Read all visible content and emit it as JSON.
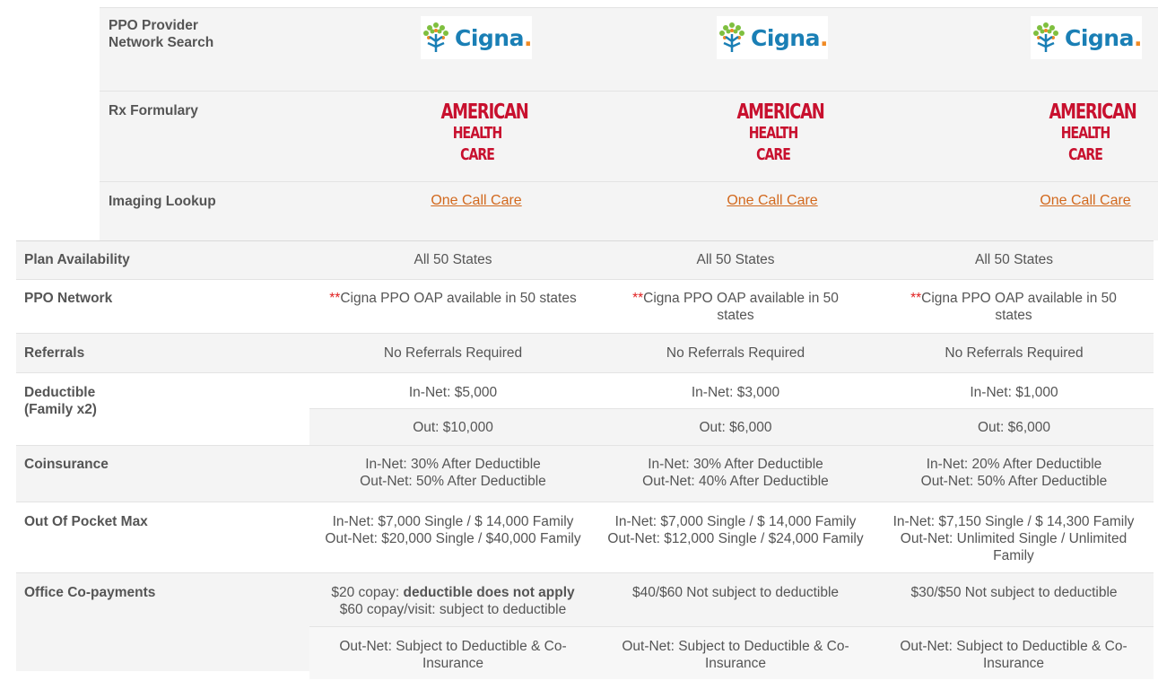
{
  "top": {
    "ppo_provider_label": "PPO Provider\nNetwork Search",
    "rx_label": "Rx Formulary",
    "imaging_label": "Imaging Lookup",
    "cigna_word": "Cigna",
    "cigna_dot": ".",
    "ahc_line1": "AMERICAN",
    "ahc_line2": "HEALTH CARE",
    "imaging_link": "One Call Care"
  },
  "rows": {
    "plan_availability": {
      "label": "Plan Availability",
      "values": [
        "All 50 States",
        "All 50 States",
        "All 50 States"
      ]
    },
    "ppo_network": {
      "label": "PPO Network",
      "mark": "**",
      "values": [
        "Cigna PPO OAP available in 50 states",
        "Cigna PPO OAP available in 50 states",
        "Cigna PPO OAP available in 50 states"
      ]
    },
    "referrals": {
      "label": "Referrals",
      "values": [
        "No Referrals Required",
        "No Referrals Required",
        "No Referrals Required"
      ]
    },
    "deductible": {
      "label1": "Deductible",
      "label2": "(Family x2)",
      "in_net": [
        "In-Net: $5,000",
        "In-Net: $3,000",
        "In-Net: $1,000"
      ],
      "out": [
        "Out: $10,000",
        "Out: $6,000",
        "Out: $6,000"
      ]
    },
    "coinsurance": {
      "label": "Coinsurance",
      "in_net": [
        "In-Net: 30% After Deductible",
        "In-Net: 30% After Deductible",
        "In-Net: 20% After Deductible"
      ],
      "out_net": [
        "Out-Net: 50% After Deductible",
        "Out-Net: 40% After Deductible",
        "Out-Net: 50% After Deductible"
      ]
    },
    "oop_max": {
      "label": "Out Of Pocket Max",
      "values": [
        "In-Net: $7,000 Single / $ 14,000 Family Out-Net: $20,000 Single / $40,000 Family",
        "In-Net: $7,000 Single / $ 14,000 Family Out-Net: $12,000 Single / $24,000 Family",
        "In-Net: $7,150 Single / $ 14,300 Family Out-Net: Unlimited Single / Unlimited Family"
      ]
    },
    "office_copay": {
      "label": "Office Co-payments",
      "col1_a": "$20 copay: ",
      "col1_bold": "deductible does not apply",
      "col1_b": "$60 copay/visit: subject to deductible",
      "col2": "$40/$60 Not subject to deductible",
      "col3": "$30/$50 Not subject to deductible",
      "out_net": [
        "Out-Net: Subject to Deductible & Co-Insurance",
        "Out-Net: Subject to Deductible & Co-Insurance",
        "Out-Net: Subject to Deductible & Co-Insurance"
      ]
    }
  }
}
